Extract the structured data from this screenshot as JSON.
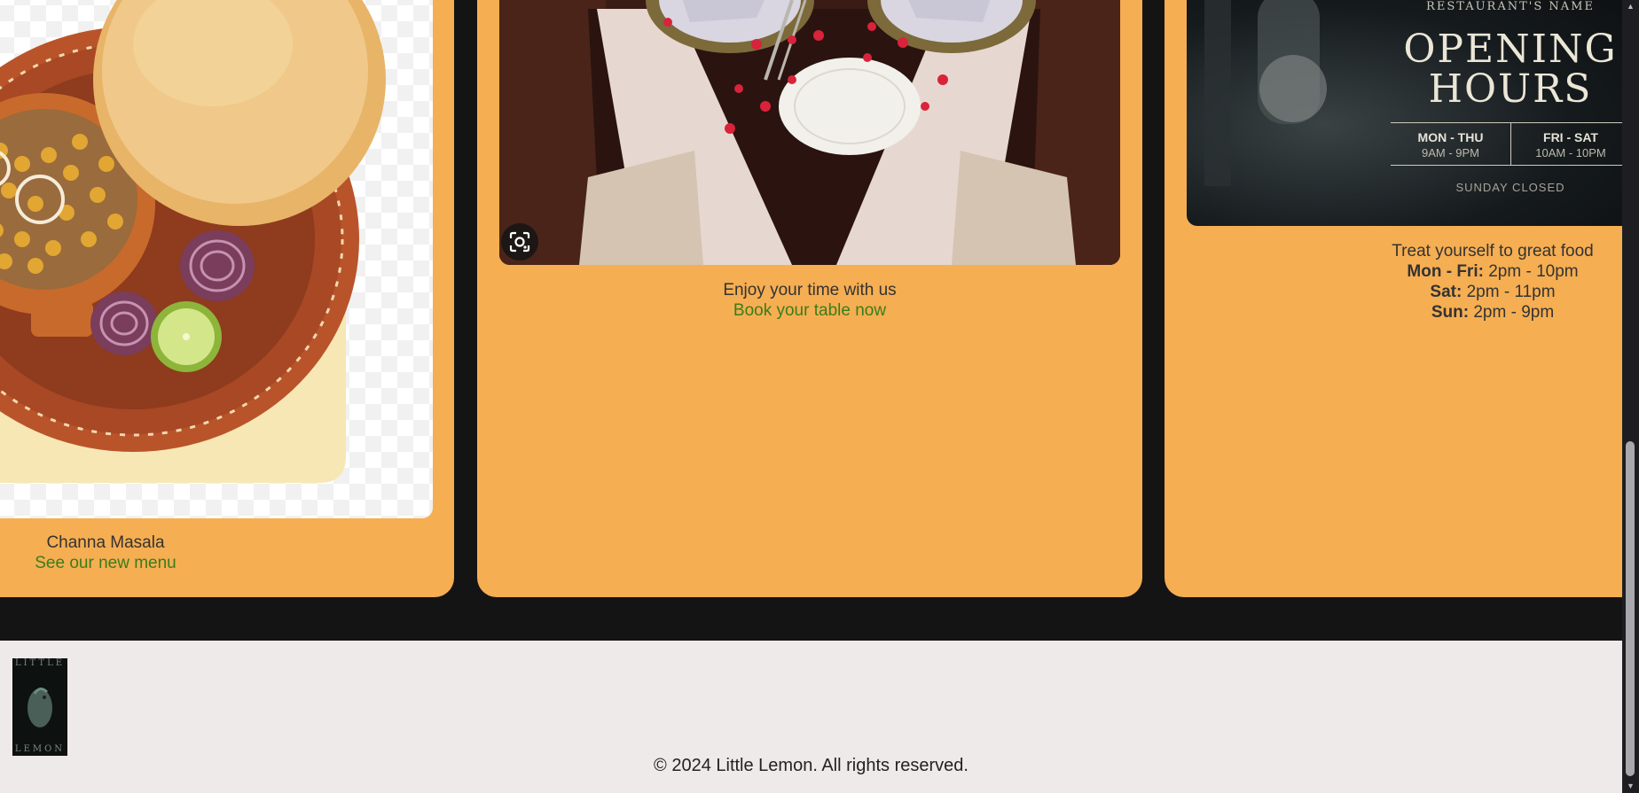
{
  "cards": [
    {
      "caption": "Channa Masala",
      "link_label": "See our new menu"
    },
    {
      "caption": "Enjoy your time with us",
      "link_label": "Book your table now"
    },
    {
      "caption": "Treat yourself to great food",
      "hours": [
        {
          "day": "Mon - Fri:",
          "time": "2pm - 10pm"
        },
        {
          "day": "Sat:",
          "time": "2pm - 11pm"
        },
        {
          "day": "Sun:",
          "time": "2pm - 9pm"
        }
      ]
    }
  ],
  "poster": {
    "top_text": "RESTAURANT'S NAME",
    "title_line1": "OPENING",
    "title_line2": "HOURS",
    "col1_days": "MON - THU",
    "col1_time": "9AM - 9PM",
    "col2_days": "FRI - SAT",
    "col2_time": "10AM - 10PM",
    "closed": "SUNDAY CLOSED"
  },
  "footer": {
    "logo_top": "LITTLE",
    "logo_bottom": "LEMON",
    "copyright": "© 2024 Little Lemon. All rights reserved."
  },
  "colors": {
    "card_bg": "#f6ae52",
    "page_bg": "#151414",
    "footer_bg": "#efeaea",
    "link": "#3a7d1a"
  },
  "icons": {
    "lens": "image-search-icon",
    "logo": "little-lemon-logo",
    "scroll_up": "chevron-up-icon",
    "scroll_down": "chevron-down-icon"
  }
}
